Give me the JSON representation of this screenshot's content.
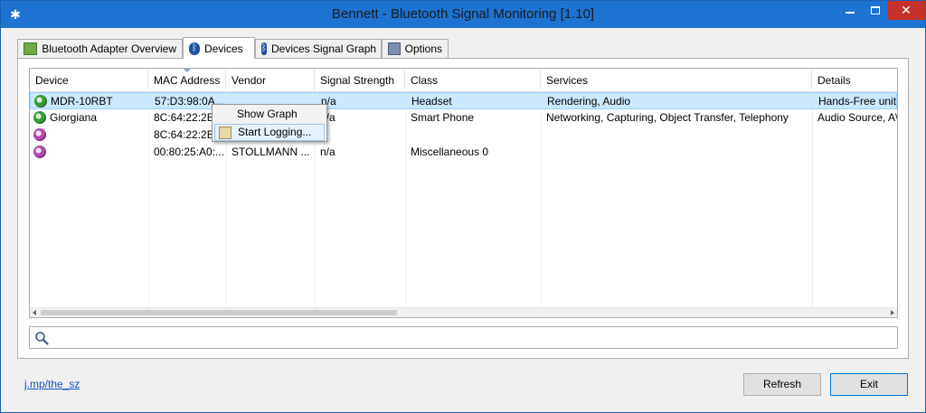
{
  "window": {
    "title": "Bennett - Bluetooth Signal Monitoring [1.10]",
    "close_label": "✕",
    "colors": {
      "titlebar": "#1e73d2",
      "close": "#c7312a",
      "selection": "#cce8ff"
    }
  },
  "tabs": [
    {
      "label": "Bluetooth Adapter Overview",
      "icon": "adapter-icon",
      "active": false
    },
    {
      "label": "Devices",
      "icon": "bluetooth-icon",
      "active": true
    },
    {
      "label": "Devices Signal Graph",
      "icon": "bluetooth-icon",
      "active": false
    },
    {
      "label": "Options",
      "icon": "options-icon",
      "active": false
    }
  ],
  "table": {
    "columns": [
      "Device",
      "MAC Address",
      "Vendor",
      "Signal Strength",
      "Class",
      "Services",
      "Details"
    ],
    "rows": [
      {
        "device": "MDR-10RBT",
        "mac": "57:D3:98:0A...",
        "vendor": "",
        "signal": "n/a",
        "class": "Headset",
        "services": "Rendering, Audio",
        "details": "Hands-Free unit,",
        "icon": "device-green",
        "selected": true
      },
      {
        "device": "Giorgiana",
        "mac": "8C:64:22:2B:...",
        "vendor": "",
        "signal": "n/a",
        "class": "Smart Phone",
        "services": "Networking, Capturing, Object Transfer, Telephony",
        "details": "Audio Source, A\\",
        "icon": "device-green",
        "selected": false
      },
      {
        "device": "",
        "mac": "8C:64:22:2B:...",
        "vendor": "",
        "signal": "",
        "class": "",
        "services": "",
        "details": "",
        "icon": "device-purple",
        "selected": false
      },
      {
        "device": "",
        "mac": "00:80:25:A0:...",
        "vendor": "STOLLMANN ...",
        "signal": "n/a",
        "class": "Miscellaneous 0",
        "services": "",
        "details": "",
        "icon": "device-purple",
        "selected": false
      }
    ]
  },
  "context_menu": {
    "items": [
      {
        "label": "Show Graph"
      },
      {
        "label": "Start Logging..."
      }
    ]
  },
  "search": {
    "value": "",
    "placeholder": ""
  },
  "footer": {
    "link": "j.mp/the_sz",
    "refresh_label": "Refresh",
    "exit_label": "Exit"
  }
}
